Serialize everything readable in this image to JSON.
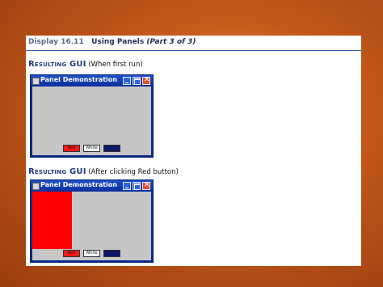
{
  "slide": {
    "display_label": "Display 16.11",
    "title": "Using Panels",
    "part": "(Part 3 of 3)"
  },
  "sections": [
    {
      "heading": "Resulting GUI",
      "note": "(When first run)",
      "window": {
        "title": "Panel Demonstration",
        "buttons": {
          "red": "Red",
          "white": "White",
          "blue": "Blue"
        },
        "red_panel_filled": false
      }
    },
    {
      "heading": "Resulting GUI",
      "note": "(After clicking Red button)",
      "window": {
        "title": "Panel Demonstration",
        "buttons": {
          "red": "Red",
          "white": "White",
          "blue": "Blue"
        },
        "red_panel_filled": true
      }
    }
  ],
  "colors": {
    "background": "#c0561a",
    "accent": "#1f3a7a",
    "titlebar": "#0a2f9a",
    "red_panel": "#ff0000",
    "panel_gray": "#c6c6c6"
  }
}
